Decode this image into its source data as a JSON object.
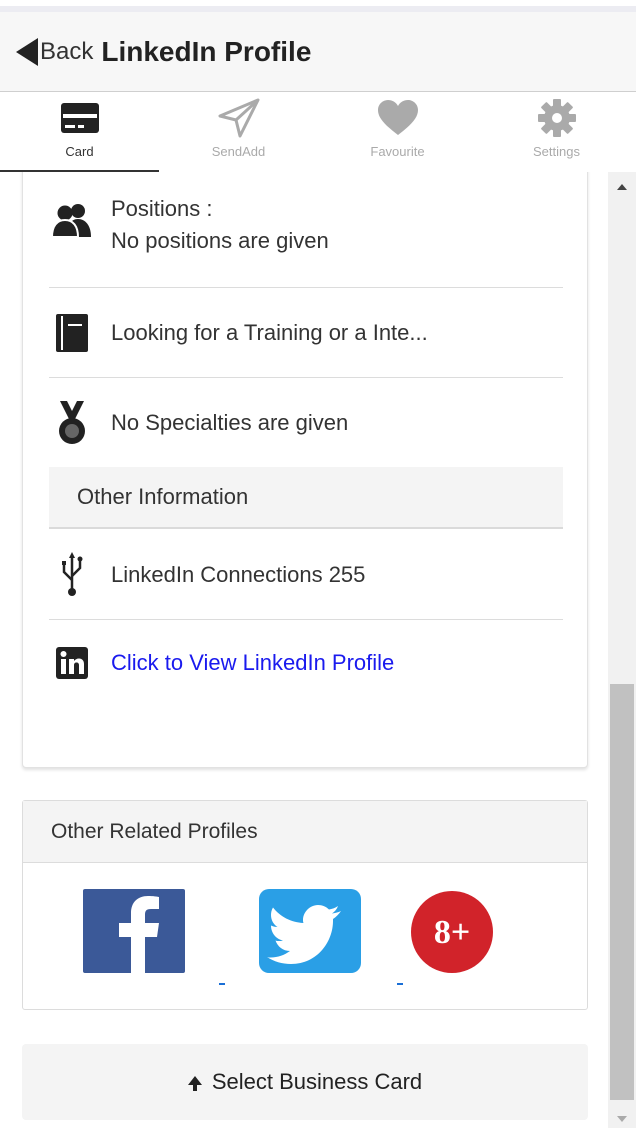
{
  "header": {
    "back_label": "Back",
    "title": "LinkedIn Profile"
  },
  "tabs": [
    {
      "label": "Card",
      "icon": "card-icon",
      "active": true
    },
    {
      "label": "SendAdd",
      "icon": "send-icon",
      "active": false
    },
    {
      "label": "Favourite",
      "icon": "heart-icon",
      "active": false
    },
    {
      "label": "Settings",
      "icon": "gear-icon",
      "active": false
    }
  ],
  "profile": {
    "positions_label": "Positions :",
    "positions_value": "No positions are given",
    "looking_for": "Looking for a Training or a Inte...",
    "specialties": "No Specialties are given",
    "other_info_heading": "Other Information",
    "connections": "LinkedIn Connections 255",
    "view_profile_link": "Click to View LinkedIn Profile"
  },
  "related": {
    "heading": "Other Related Profiles",
    "facebook_glyph": "f",
    "googleplus_glyph": "8+"
  },
  "select_button": {
    "label": "Select Business Card"
  },
  "colors": {
    "link": "#1a1aee",
    "facebook": "#3b5998",
    "twitter": "#2a9fe6",
    "googleplus": "#d1232a"
  }
}
